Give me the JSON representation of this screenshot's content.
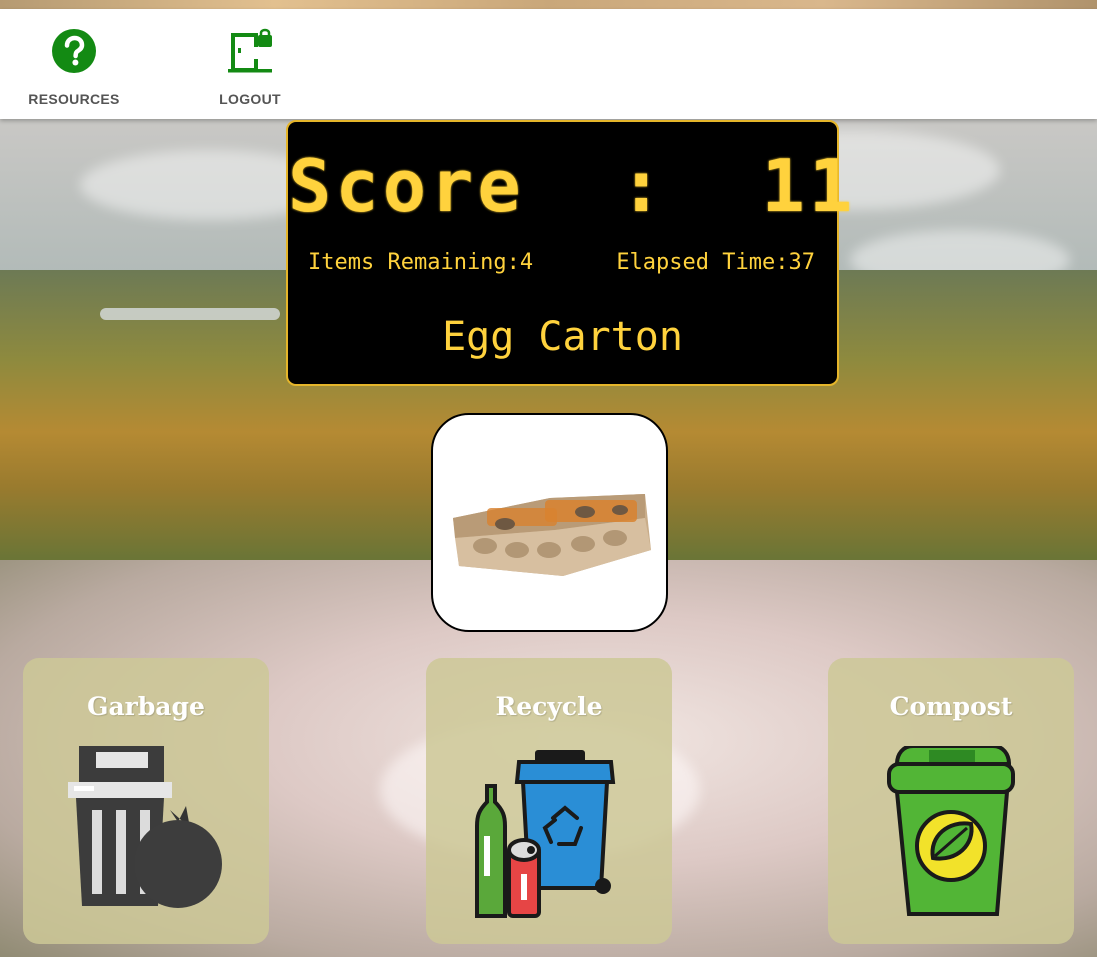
{
  "nav": {
    "resources_label": "RESOURCES",
    "logout_label": "LOGOUT",
    "accent_color": "#138a13"
  },
  "scoreboard": {
    "score_label": "Score",
    "separator": ":",
    "score_value": "11",
    "items_remaining_label": "Items Remaining:",
    "items_remaining_value": "4",
    "elapsed_time_label": "Elapsed Time:",
    "elapsed_time_value": "37",
    "current_item": "Egg Carton",
    "text_color": "#ffd23d"
  },
  "item_card": {
    "image": "egg-carton-image"
  },
  "bins": {
    "garbage_label": "Garbage",
    "recycle_label": "Recycle",
    "compost_label": "Compost"
  }
}
